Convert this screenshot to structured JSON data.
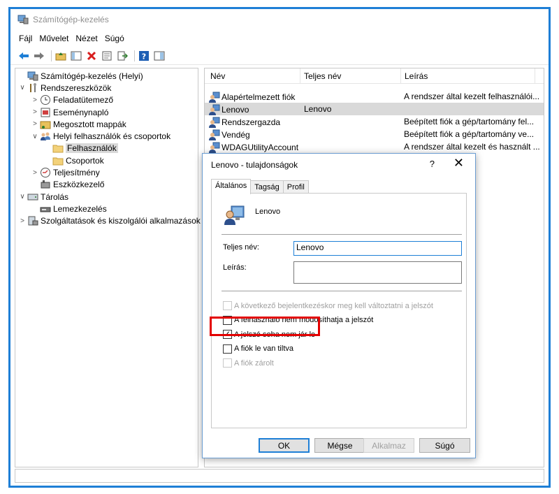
{
  "window": {
    "title": "Számítógép-kezelés"
  },
  "menu": [
    "Fájl",
    "Művelet",
    "Nézet",
    "Súgó"
  ],
  "toolbar_icons": [
    "back-arrow-icon",
    "forward-arrow-icon",
    "up-folder-icon",
    "show-hide-tree-icon",
    "delete-icon",
    "properties-icon",
    "export-list-icon",
    "help-icon",
    "action-pane-icon"
  ],
  "tree": [
    {
      "label": "Számítógép-kezelés (Helyi)",
      "level": 0,
      "chev": "",
      "icon": "computer-management-icon"
    },
    {
      "label": "Rendszereszközök",
      "level": 0,
      "chev": "∨",
      "icon": "tools-icon"
    },
    {
      "label": "Feladatütemező",
      "level": 1,
      "chev": ">",
      "icon": "clock-icon"
    },
    {
      "label": "Eseménynapló",
      "level": 1,
      "chev": ">",
      "icon": "event-log-icon"
    },
    {
      "label": "Megosztott mappák",
      "level": 1,
      "chev": ">",
      "icon": "shared-folder-icon"
    },
    {
      "label": "Helyi felhasználók és csoportok",
      "level": 1,
      "chev": "∨",
      "icon": "users-groups-icon"
    },
    {
      "label": "Felhasználók",
      "level": 2,
      "chev": "",
      "icon": "folder-icon",
      "selected": true
    },
    {
      "label": "Csoportok",
      "level": 2,
      "chev": "",
      "icon": "folder-icon"
    },
    {
      "label": "Teljesítmény",
      "level": 1,
      "chev": ">",
      "icon": "performance-icon"
    },
    {
      "label": "Eszközkezelő",
      "level": 1,
      "chev": "",
      "icon": "device-manager-icon"
    },
    {
      "label": "Tárolás",
      "level": 0,
      "chev": "∨",
      "icon": "storage-icon"
    },
    {
      "label": "Lemezkezelés",
      "level": 1,
      "chev": "",
      "icon": "disk-icon"
    },
    {
      "label": "Szolgáltatások és kiszolgálói alkalmazások",
      "level": 0,
      "chev": ">",
      "icon": "services-icon"
    }
  ],
  "list": {
    "columns": [
      "Név",
      "Teljes név",
      "Leírás"
    ],
    "rows": [
      {
        "name": "Alapértelmezett fiók",
        "full": "",
        "desc": "A rendszer által kezelt felhasználói..."
      },
      {
        "name": "Lenovo",
        "full": "Lenovo",
        "desc": "",
        "selected": true
      },
      {
        "name": "Rendszergazda",
        "full": "",
        "desc": "Beépített fiók a gép/tartomány fel..."
      },
      {
        "name": "Vendég",
        "full": "",
        "desc": "Beépített fiók a gép/tartomány ve..."
      },
      {
        "name": "WDAGUtilityAccount",
        "full": "",
        "desc": "A rendszer által kezelt és használt ..."
      }
    ]
  },
  "dialog": {
    "title": "Lenovo - tulajdonságok",
    "help": "?",
    "close": "✕",
    "tabs": [
      "Általános",
      "Tagság",
      "Profil"
    ],
    "user_name": "Lenovo",
    "full_name_label": "Teljes név:",
    "full_name_value": "Lenovo",
    "description_label": "Leírás:",
    "description_value": "",
    "checkboxes": [
      {
        "label": "A következő bejelentkezéskor meg kell változtatni a jelszót",
        "checked": false,
        "disabled": true
      },
      {
        "label": "A felhasználó nem módosíthatja a jelszót",
        "checked": false,
        "disabled": false
      },
      {
        "label": "A jelszó soha nem jár le",
        "checked": true,
        "disabled": false
      },
      {
        "label": "A fiók le van tiltva",
        "checked": false,
        "disabled": false
      },
      {
        "label": "A fiók zárolt",
        "checked": false,
        "disabled": true
      }
    ],
    "buttons": {
      "ok": "OK",
      "cancel": "Mégse",
      "apply": "Alkalmaz",
      "help": "Súgó"
    }
  },
  "colors": {
    "frame": "#1e7fd6",
    "highlight": "#e30000",
    "selection": "#d9d9d9"
  }
}
